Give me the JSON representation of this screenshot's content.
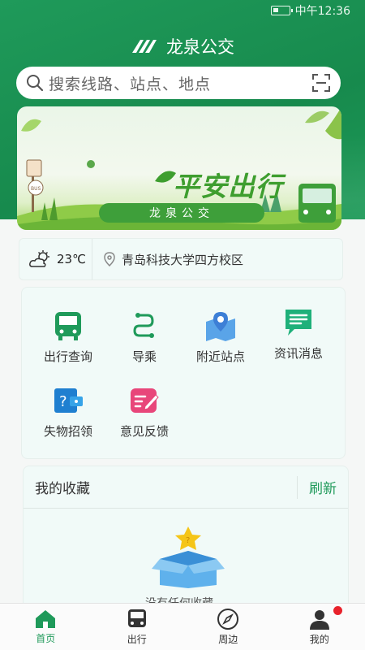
{
  "status_bar": {
    "time": "中午12:36"
  },
  "app": {
    "title": "龙泉公交"
  },
  "search": {
    "placeholder": "搜索线路、站点、地点"
  },
  "banner": {
    "slogan": "平安出行",
    "pill_text": "龙泉公交",
    "sign_text": "BUS"
  },
  "weather": {
    "temperature": "23℃",
    "icon": "partly-sunny-icon"
  },
  "location": {
    "name": "青岛科技大学四方校区",
    "icon": "location-pin-icon"
  },
  "services": [
    {
      "label": "出行查询",
      "icon": "bus-icon"
    },
    {
      "label": "导乘",
      "icon": "route-icon"
    },
    {
      "label": "附近站点",
      "icon": "map-pin-icon"
    },
    {
      "label": "资讯消息",
      "icon": "message-icon"
    },
    {
      "label": "失物招领",
      "icon": "lost-found-icon"
    },
    {
      "label": "意见反馈",
      "icon": "feedback-icon"
    }
  ],
  "favorites": {
    "title": "我的收藏",
    "refresh_label": "刷新",
    "empty_text": "没有任何收藏"
  },
  "tabs": [
    {
      "label": "首页",
      "active": true
    },
    {
      "label": "出行",
      "active": false
    },
    {
      "label": "周边",
      "active": false
    },
    {
      "label": "我的",
      "active": false
    }
  ],
  "colors": {
    "brand": "#1f9a5a",
    "badge": "#e8222b"
  }
}
